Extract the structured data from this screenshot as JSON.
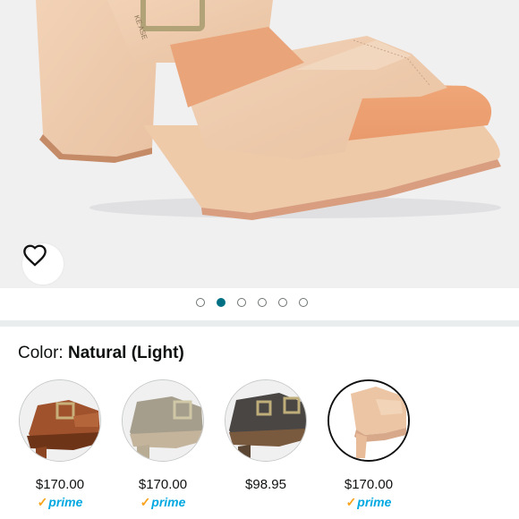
{
  "gallery": {
    "image_name": "natural-light-sandal-photo",
    "image_count": 6,
    "active_index": 1,
    "wishlist_icon": "heart-outline-icon",
    "accent": "#007185"
  },
  "color": {
    "label": "Color: ",
    "selected_value": "Natural (Light)"
  },
  "swatches": [
    {
      "price": "$170.00",
      "prime": "prime",
      "color": "#a0522d",
      "selected": false
    },
    {
      "price": "$170.00",
      "prime": "prime",
      "color": "#a69e8c",
      "selected": false
    },
    {
      "price": "$98.95",
      "prime": null,
      "color": "#4a4644",
      "selected": false
    },
    {
      "price": "$170.00",
      "prime": "prime",
      "color": "#ecc6a4",
      "selected": true
    }
  ],
  "colors": {
    "prime_blue": "#00a8e1",
    "prime_check": "#f7a31c",
    "dot_active": "#007185"
  }
}
